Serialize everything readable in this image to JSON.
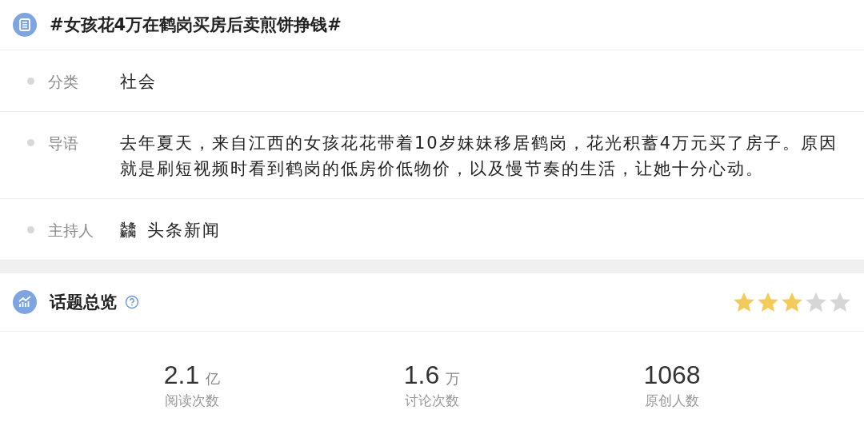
{
  "topic": {
    "title": "#女孩花4万在鹤岗买房后卖煎饼挣钱#"
  },
  "details": [
    {
      "label": "分类",
      "kind": "text",
      "value": "社会"
    },
    {
      "label": "导语",
      "kind": "text",
      "value": "去年夏天，来自江西的女孩花花带着10岁妹妹移居鹤岗，花光积蓄4万元买了房子。原因就是刷短视频时看到鹤岗的低房价低物价，以及慢节奏的生活，让她十分心动。"
    },
    {
      "label": "主持人",
      "kind": "host",
      "logo": [
        "头条",
        "新闻"
      ],
      "value": "头条新闻"
    }
  ],
  "overview": {
    "title": "话题总览",
    "stars": 3,
    "stats": [
      {
        "value": "2.1",
        "unit": "亿",
        "label": "阅读次数"
      },
      {
        "value": "1.6",
        "unit": "万",
        "label": "讨论次数"
      },
      {
        "value": "1068",
        "label": "原创人数"
      }
    ]
  }
}
